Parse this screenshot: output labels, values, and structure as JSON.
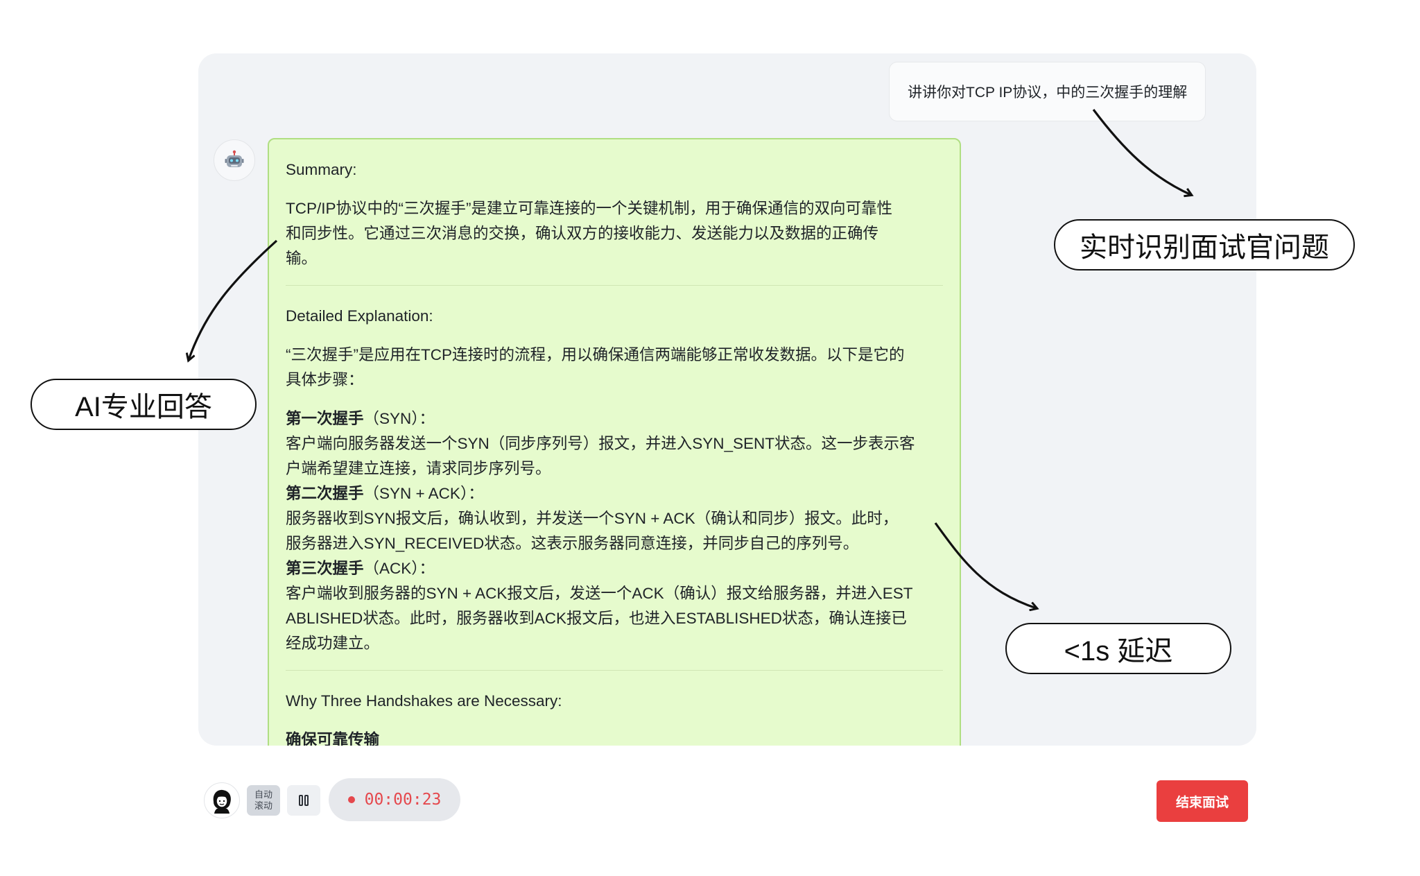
{
  "chat": {
    "user_message": "讲讲你对TCP IP协议，中的三次握手的理解",
    "answer": {
      "summary_heading": "Summary:",
      "summary_lines": [
        "TCP/IP协议中的“三次握手”是建立可靠连接的一个关键机制，用于确保通信的双向可靠性",
        "和同步性。它通过三次消息的交换，确认双方的接收能力、发送能力以及数据的正确传",
        "输。"
      ],
      "detail_heading": "Detailed Explanation:",
      "detail_intro_lines": [
        "“三次握手”是应用在TCP连接时的流程，用以确保通信两端能够正常收发数据。以下是它的",
        "具体步骤："
      ],
      "steps": [
        {
          "title": "第一次握手",
          "tag": "（SYN）：",
          "lines": [
            "客户端向服务器发送一个SYN（同步序列号）报文，并进入SYN_SENT状态。这一步表示客",
            "户端希望建立连接，请求同步序列号。"
          ]
        },
        {
          "title": "第二次握手",
          "tag": "（SYN + ACK）：",
          "lines": [
            "服务器收到SYN报文后，确认收到，并发送一个SYN + ACK（确认和同步）报文。此时，",
            "服务器进入SYN_RECEIVED状态。这表示服务器同意连接，并同步自己的序列号。"
          ]
        },
        {
          "title": "第三次握手",
          "tag": "（ACK）：",
          "lines": [
            "客户端收到服务器的SYN + ACK报文后，发送一个ACK（确认）报文给服务器，并进入EST",
            "ABLISHED状态。此时，服务器收到ACK报文后，也进入ESTABLISHED状态，确认连接已",
            "经成功建立。"
          ]
        }
      ],
      "why_heading": "Why Three Handshakes are Necessary:",
      "cut_line": "确保可靠传输"
    }
  },
  "annotations": {
    "realtime": "实时识别面试官问题",
    "ai_answer": "AI专业回答",
    "latency": "<1s 延迟"
  },
  "controls": {
    "auto_scroll_label": "自动\n滚动",
    "timer": "00:00:23",
    "end_button": "结束面试"
  },
  "icons": {
    "bot_avatar": "robot-icon",
    "user_avatar": "user-avatar-icon",
    "pause": "pause-icon",
    "record": "record-dot-icon"
  },
  "colors": {
    "answer_bg": "#e6fbcd",
    "answer_border": "#b0de82",
    "panel_bg": "#f1f3f6",
    "timer_red": "#e5484d",
    "end_button": "#ea3f3f"
  }
}
